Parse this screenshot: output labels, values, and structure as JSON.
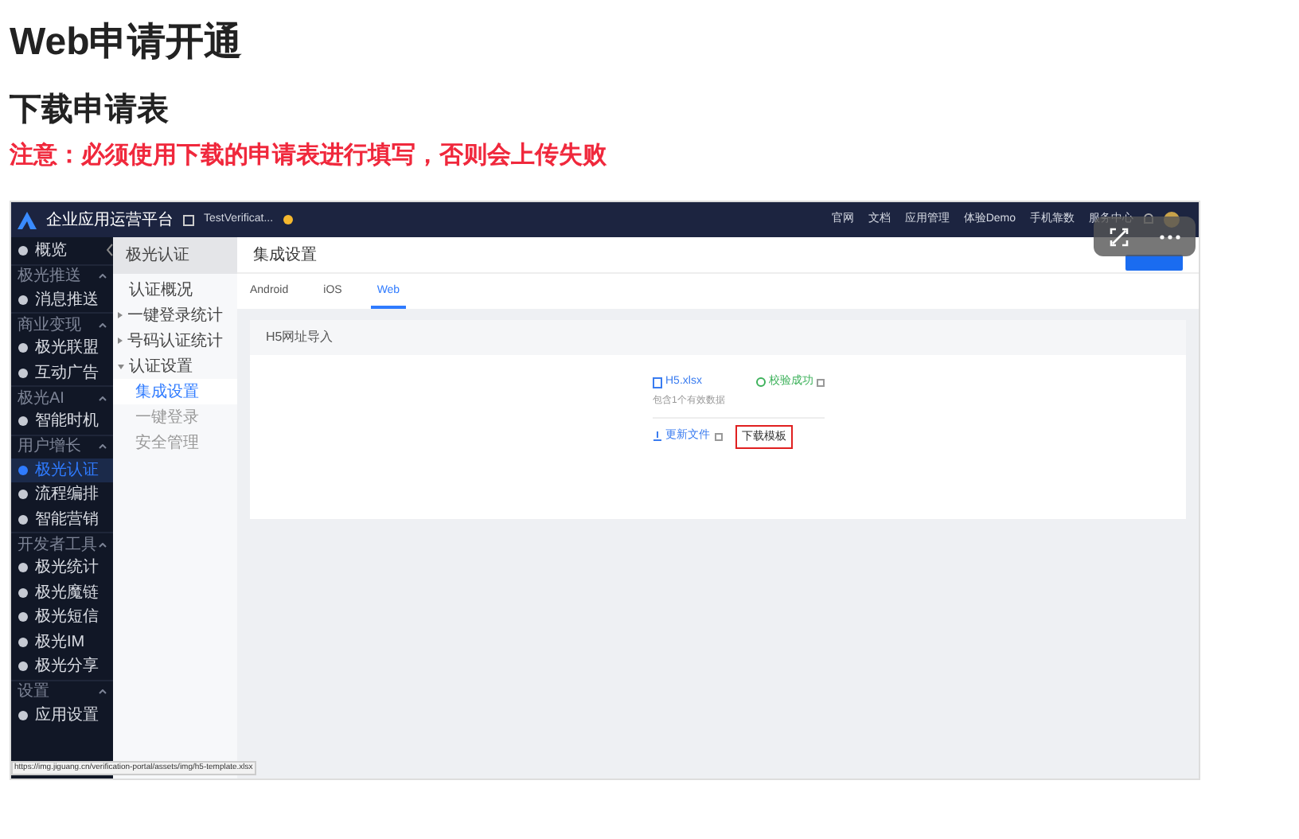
{
  "page": {
    "title": "Web申请开通",
    "subtitle": "下载申请表",
    "notice": "注意：必须使用下载的申请表进行填写，否则会上传失败"
  },
  "screenshot": {
    "topbar": {
      "brand": "企业应用运营平台",
      "app": "TestVerificat...",
      "nav": [
        "官网",
        "文档",
        "应用管理",
        "体验Demo",
        "手机靠数",
        "服务中心"
      ]
    },
    "sidebar": [
      {
        "kind": "item",
        "label": "概览",
        "selected": false
      },
      {
        "kind": "section",
        "label": "极光推送"
      },
      {
        "kind": "item",
        "label": "消息推送",
        "selected": false
      },
      {
        "kind": "section",
        "label": "商业变现"
      },
      {
        "kind": "item",
        "label": "极光联盟",
        "selected": false
      },
      {
        "kind": "item",
        "label": "互动广告",
        "selected": false
      },
      {
        "kind": "section",
        "label": "极光AI"
      },
      {
        "kind": "item",
        "label": "智能时机",
        "selected": false
      },
      {
        "kind": "section",
        "label": "用户增长"
      },
      {
        "kind": "item",
        "label": "极光认证",
        "selected": true
      },
      {
        "kind": "item",
        "label": "流程编排",
        "selected": false
      },
      {
        "kind": "item",
        "label": "智能营销",
        "selected": false
      },
      {
        "kind": "section",
        "label": "开发者工具"
      },
      {
        "kind": "item",
        "label": "极光统计",
        "selected": false
      },
      {
        "kind": "item",
        "label": "极光魔链",
        "selected": false
      },
      {
        "kind": "item",
        "label": "极光短信",
        "selected": false
      },
      {
        "kind": "item",
        "label": "极光IM",
        "selected": false
      },
      {
        "kind": "item",
        "label": "极光分享",
        "selected": false
      },
      {
        "kind": "section",
        "label": "设置"
      },
      {
        "kind": "item",
        "label": "应用设置",
        "selected": false
      }
    ],
    "subnav": {
      "title": "极光认证",
      "items": [
        {
          "label": "认证概况",
          "selected": false
        },
        {
          "label": "一键登录统计",
          "selected": false,
          "expanded": false
        },
        {
          "label": "号码认证统计",
          "selected": false,
          "expanded": false
        },
        {
          "label": "认证设置",
          "selected": false,
          "expanded": true,
          "children": [
            {
              "label": "集成设置",
              "selected": true
            },
            {
              "label": "一键登录",
              "selected": false
            },
            {
              "label": "安全管理",
              "selected": false
            }
          ]
        }
      ]
    },
    "heading": "集成设置",
    "tabs": [
      {
        "label": "Android",
        "selected": false
      },
      {
        "label": "iOS",
        "selected": false
      },
      {
        "label": "Web",
        "selected": true
      }
    ],
    "card": {
      "title": "H5网址导入",
      "file": "H5.xlsx",
      "status": "校验成功",
      "file_note": "包含1个有效数据",
      "update_link": "更新文件",
      "download_button": "下载模板"
    },
    "link_preview": "https://img.jiguang.cn/verification-portal/assets/img/h5-template.xlsx"
  }
}
